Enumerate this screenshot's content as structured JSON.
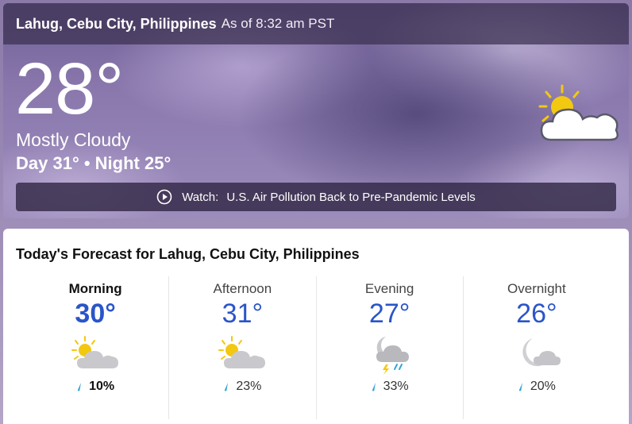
{
  "location": {
    "name": "Lahug, Cebu City, Philippines",
    "as_of": "As of 8:32 am PST"
  },
  "current": {
    "temperature": "28°",
    "condition": "Mostly Cloudy",
    "day_night": "Day 31° • Night 25°",
    "icon": "partly-sunny-icon"
  },
  "watch": {
    "label": "Watch:",
    "headline": "U.S. Air Pollution Back to Pre-Pandemic Levels",
    "icon": "play-icon"
  },
  "forecast": {
    "title": "Today's Forecast for Lahug, Cebu City, Philippines",
    "periods": [
      {
        "name": "Morning",
        "temp": "30°",
        "precip": "10%",
        "icon": "partly-sunny-icon"
      },
      {
        "name": "Afternoon",
        "temp": "31°",
        "precip": "23%",
        "icon": "partly-sunny-icon"
      },
      {
        "name": "Evening",
        "temp": "27°",
        "precip": "33%",
        "icon": "night-thunderstorm-icon"
      },
      {
        "name": "Overnight",
        "temp": "26°",
        "precip": "20%",
        "icon": "night-cloudy-icon"
      }
    ]
  },
  "colors": {
    "temp_blue": "#2a55c9",
    "sun_yellow": "#f2c811",
    "drop_blue": "#36a6d8"
  }
}
